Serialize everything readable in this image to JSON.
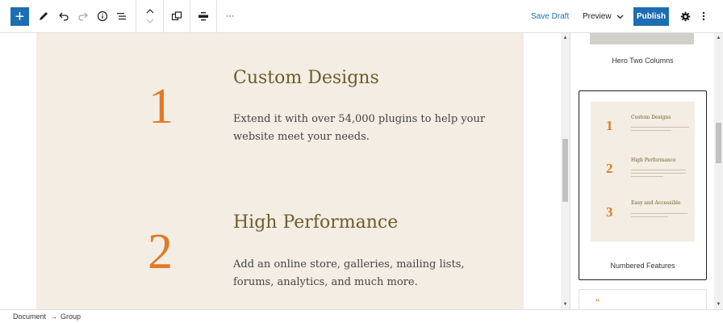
{
  "toolbar": {
    "add_label": "+",
    "save_draft": "Save Draft",
    "preview": "Preview",
    "publish": "Publish",
    "more_glyph": "···"
  },
  "canvas": {
    "features": [
      {
        "number": "1",
        "title": "Custom Designs",
        "body_line1": "Extend it with over 54,000 plugins to help your",
        "body_line2": "website meet your needs."
      },
      {
        "number": "2",
        "title": "High Performance",
        "body_line1": "Add an online store, galleries, mailing lists,",
        "body_line2": "forums, analytics, and much more."
      }
    ]
  },
  "sidebar": {
    "cards": [
      {
        "label": "Hero Two Columns"
      },
      {
        "label": "Numbered Features"
      }
    ],
    "mini_features": [
      {
        "number": "1",
        "title": "Custom Designs"
      },
      {
        "number": "2",
        "title": "High Performance"
      },
      {
        "number": "3",
        "title": "Easy and Accessible"
      }
    ],
    "next_card_mark": "“"
  },
  "footer": {
    "crumb1": "Document",
    "arrow": "→",
    "crumb2": "Group"
  }
}
